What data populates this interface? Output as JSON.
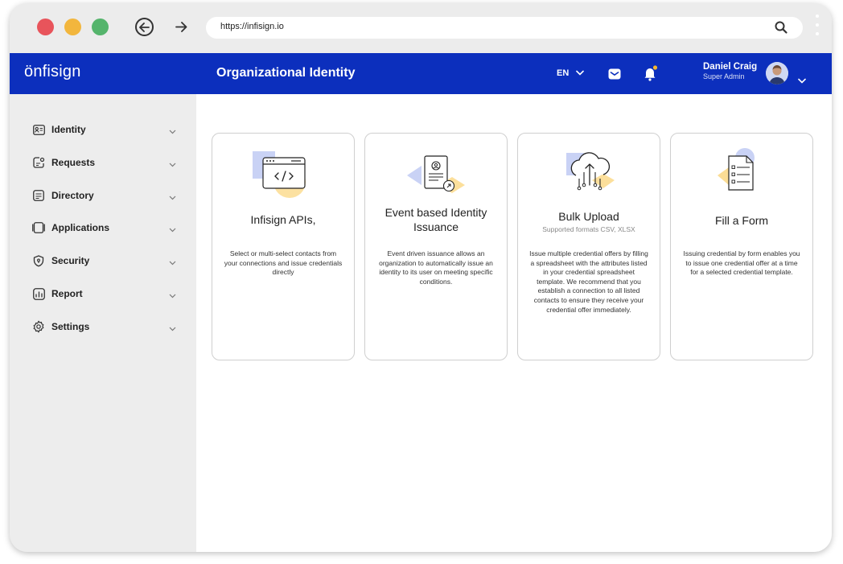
{
  "browser": {
    "url": "https://infisign.io"
  },
  "appbar": {
    "logo_prefix": "ö",
    "logo_text": "nfisign",
    "page_title": "Organizational Identity",
    "language": "EN",
    "user_name": "Daniel Craig",
    "user_role": "Super Admin"
  },
  "sidebar": {
    "items": [
      {
        "label": "Identity",
        "icon": "id-card-icon"
      },
      {
        "label": "Requests",
        "icon": "requests-icon"
      },
      {
        "label": "Directory",
        "icon": "directory-icon"
      },
      {
        "label": "Applications",
        "icon": "applications-icon"
      },
      {
        "label": "Security",
        "icon": "shield-icon"
      },
      {
        "label": "Report",
        "icon": "report-icon"
      },
      {
        "label": "Settings",
        "icon": "gear-icon"
      }
    ]
  },
  "cards": [
    {
      "title": "Infisign APIs,",
      "subtitle": "",
      "description": "Select or multi-select contacts from your connections and issue credentials directly",
      "icon": "code-window-icon"
    },
    {
      "title": "Event based Identity Issuance",
      "subtitle": "",
      "description": "Event driven issuance allows an organization to automatically issue an identity to its user on meeting specific conditions.",
      "icon": "identity-document-icon"
    },
    {
      "title": "Bulk Upload",
      "subtitle": "Supported formats CSV, XLSX",
      "description": "Issue multiple credential offers by filling a spreadsheet with the attributes listed in your credential spreadsheet template. We recommend that you establish a connection to all listed contacts to ensure they receive your credential offer immediately.",
      "icon": "cloud-upload-icon"
    },
    {
      "title": "Fill a Form",
      "subtitle": "",
      "description": "Issuing credential by form enables you to issue one credential offer at a time for a selected credential template.",
      "icon": "form-checklist-icon"
    }
  ],
  "colors": {
    "appbar": "#0c2fbd",
    "accent_yellow": "#f5b82e",
    "accent_blue_light": "#c9d2f5"
  }
}
